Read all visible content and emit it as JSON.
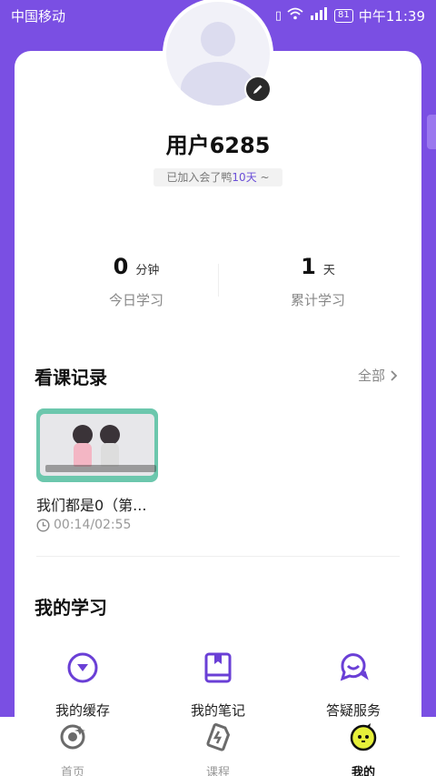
{
  "status_bar": {
    "carrier": "中国移动",
    "network": "4G",
    "battery": "81",
    "time": "中午11:39"
  },
  "profile": {
    "username": "用户6285",
    "join_prefix": "已加入会了鸭",
    "join_days": "10天",
    "join_suffix": " ~"
  },
  "stats": {
    "today": {
      "value": "0",
      "unit": "分钟",
      "label": "今日学习"
    },
    "total": {
      "value": "1",
      "unit": "天",
      "label": "累计学习"
    }
  },
  "history": {
    "title": "看课记录",
    "all_label": "全部",
    "items": [
      {
        "title": "我们都是0（第...",
        "progress": "00:14/02:55"
      }
    ]
  },
  "my_study": {
    "title": "我的学习",
    "items": [
      {
        "label": "我的缓存",
        "icon": "download-cache-icon"
      },
      {
        "label": "我的笔记",
        "icon": "notebook-icon"
      },
      {
        "label": "答疑服务",
        "icon": "chat-help-icon"
      }
    ]
  },
  "bottom_nav": {
    "items": [
      {
        "label": "首页",
        "icon": "home-icon",
        "active": false
      },
      {
        "label": "课程",
        "icon": "course-icon",
        "active": false
      },
      {
        "label": "我的",
        "icon": "profile-mascot-icon",
        "active": true
      }
    ]
  },
  "colors": {
    "accent": "#7a4fe3",
    "icon_purple": "#6a3fd6",
    "mascot_yellow": "#e6f03a"
  }
}
